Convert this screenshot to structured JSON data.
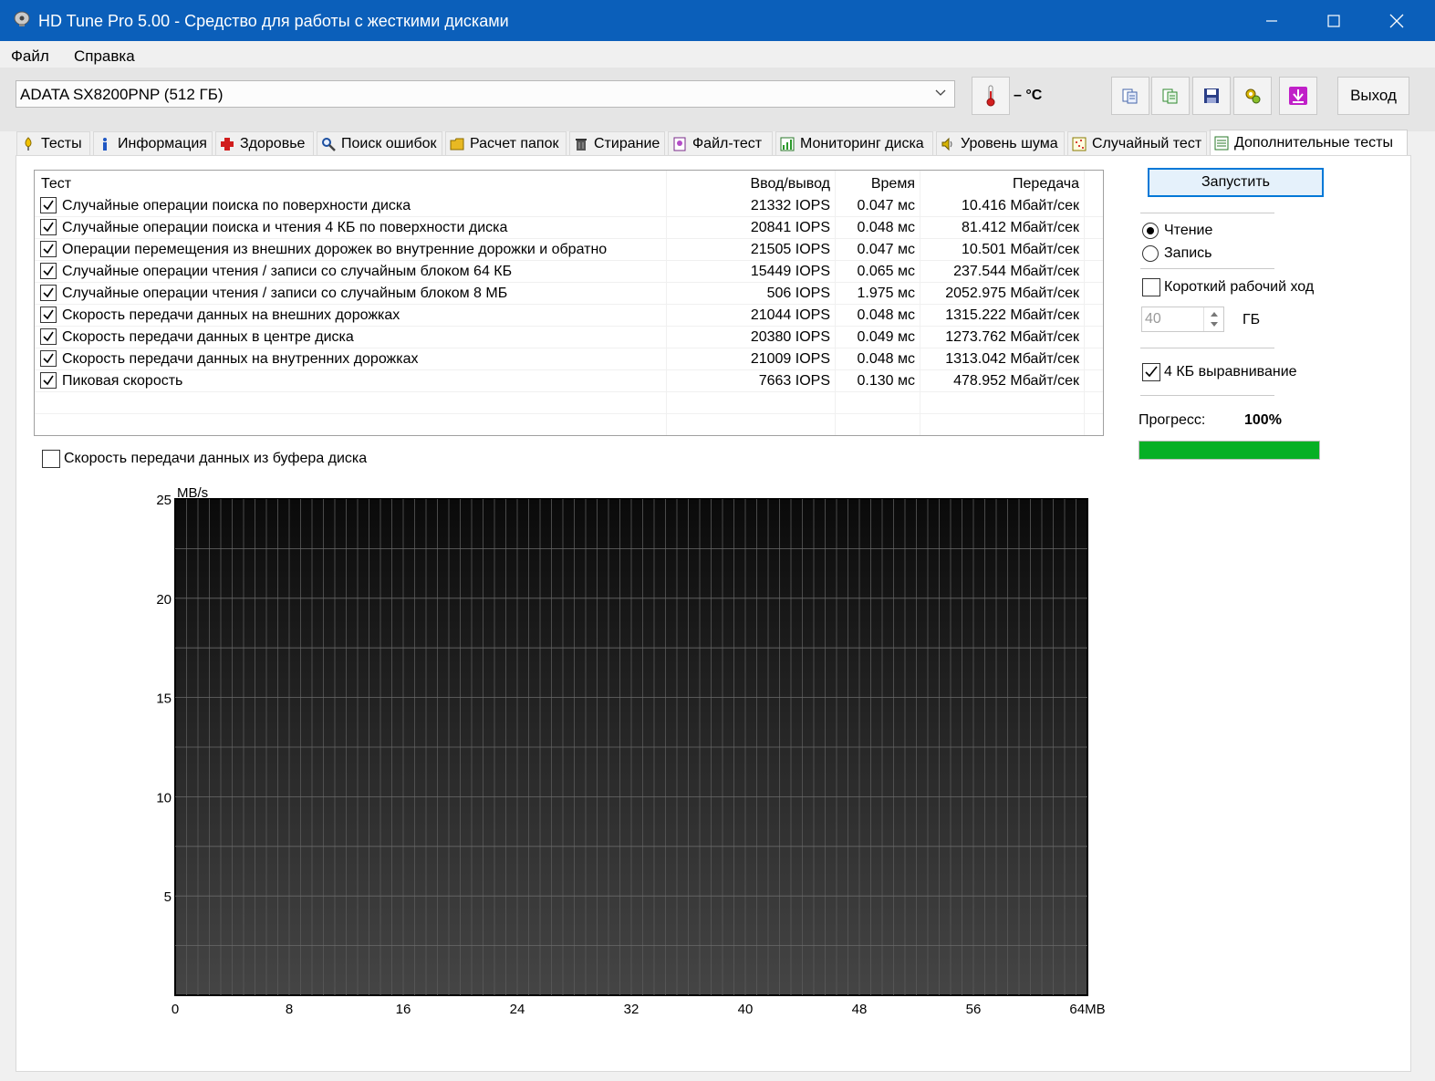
{
  "window": {
    "title": "HD Tune Pro 5.00 - Средство для работы с жесткими дисками"
  },
  "menu": {
    "items": [
      "Файл",
      "Справка"
    ]
  },
  "toolbar": {
    "drive": "ADATA SX8200PNP (512 ГБ)",
    "temperature": "– °C",
    "exit_label": "Выход",
    "buttons": [
      "copy-info-icon",
      "copy-results-icon",
      "save-icon",
      "options-icon",
      "download-icon"
    ]
  },
  "tabs": [
    {
      "label": "Тесты",
      "icon": "benchmark-icon"
    },
    {
      "label": "Информация",
      "icon": "info-icon"
    },
    {
      "label": "Здоровье",
      "icon": "health-icon"
    },
    {
      "label": "Поиск ошибок",
      "icon": "error-scan-icon"
    },
    {
      "label": "Расчет папок",
      "icon": "folder-icon"
    },
    {
      "label": "Стирание",
      "icon": "erase-icon"
    },
    {
      "label": "Файл-тест",
      "icon": "file-test-icon"
    },
    {
      "label": "Мониторинг диска",
      "icon": "monitor-icon"
    },
    {
      "label": "Уровень шума",
      "icon": "noise-icon"
    },
    {
      "label": "Случайный тест",
      "icon": "random-test-icon"
    },
    {
      "label": "Дополнительные тесты",
      "icon": "extra-tests-icon"
    }
  ],
  "results": {
    "headers": {
      "test": "Тест",
      "io": "Ввод/вывод",
      "time": "Время",
      "transfer": "Передача"
    },
    "rows": [
      {
        "checked": true,
        "test": "Случайные операции поиска по поверхности диска",
        "io": "21332 IOPS",
        "time": "0.047 мс",
        "transfer": "10.416 Мбайт/сек"
      },
      {
        "checked": true,
        "test": "Случайные операции поиска и чтения 4 КБ по поверхности диска",
        "io": "20841 IOPS",
        "time": "0.048 мс",
        "transfer": "81.412 Мбайт/сек"
      },
      {
        "checked": true,
        "test": "Операции перемещения из внешних дорожек во внутренние дорожки и обратно",
        "io": "21505 IOPS",
        "time": "0.047 мс",
        "transfer": "10.501 Мбайт/сек"
      },
      {
        "checked": true,
        "test": "Случайные операции чтения / записи со случайным блоком 64 КБ",
        "io": "15449 IOPS",
        "time": "0.065 мс",
        "transfer": "237.544 Мбайт/сек"
      },
      {
        "checked": true,
        "test": "Случайные операции чтения / записи со случайным блоком 8 МБ",
        "io": "506 IOPS",
        "time": "1.975 мс",
        "transfer": "2052.975 Мбайт/сек"
      },
      {
        "checked": true,
        "test": "Скорость передачи данных на внешних дорожках",
        "io": "21044 IOPS",
        "time": "0.048 мс",
        "transfer": "1315.222 Мбайт/сек"
      },
      {
        "checked": true,
        "test": "Скорость передачи данных в центре диска",
        "io": "20380 IOPS",
        "time": "0.049 мс",
        "transfer": "1273.762 Мбайт/сек"
      },
      {
        "checked": true,
        "test": "Скорость передачи данных на внутренних дорожках",
        "io": "21009 IOPS",
        "time": "0.048 мс",
        "transfer": "1313.042 Мбайт/сек"
      },
      {
        "checked": true,
        "test": "Пиковая скорость",
        "io": "7663 IOPS",
        "time": "0.130 мс",
        "transfer": "478.952 Мбайт/сек"
      }
    ]
  },
  "buffer_option": {
    "label": "Скорость передачи данных из буфера диска",
    "checked": false
  },
  "controls": {
    "start_label": "Запустить",
    "read_label": "Чтение",
    "write_label": "Запись",
    "mode": "read",
    "short_stroke_label": "Короткий рабочий ход",
    "short_stroke_checked": false,
    "short_stroke_value": "40",
    "short_stroke_unit": "ГБ",
    "align_label": "4 КБ выравнивание",
    "align_checked": true,
    "progress_label": "Прогресс:",
    "progress_text": "100%",
    "progress_value": 1.0,
    "progress_color": "#06b025"
  },
  "chart_data": {
    "type": "bar",
    "unit_label": "MB/s",
    "ylim": [
      0,
      25
    ],
    "y_ticks": [
      5,
      10,
      15,
      20,
      25
    ],
    "x_ticks": [
      "0",
      "8",
      "16",
      "24",
      "32",
      "40",
      "48",
      "56",
      "64MB"
    ],
    "xlim": [
      0,
      64
    ],
    "values": [],
    "grid": true
  }
}
